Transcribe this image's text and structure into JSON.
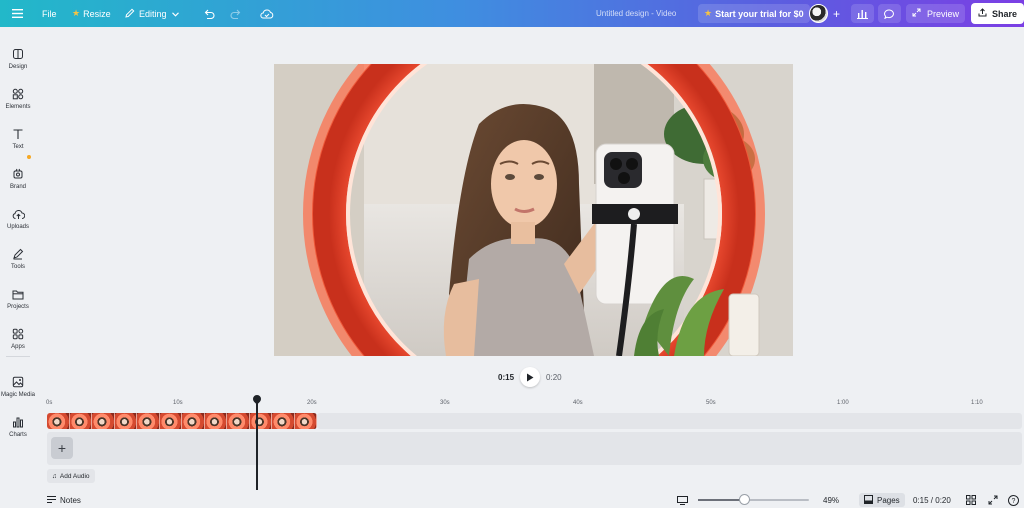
{
  "topbar": {
    "file_label": "File",
    "resize_label": "Resize",
    "editing_label": "Editing",
    "doc_title": "Untitled design - Video",
    "trial_label": "Start your trial for $0",
    "preview_label": "Preview",
    "share_label": "Share"
  },
  "sidebar": {
    "items": [
      {
        "label": "Design",
        "icon": "design-icon"
      },
      {
        "label": "Elements",
        "icon": "elements-icon"
      },
      {
        "label": "Text",
        "icon": "text-icon"
      },
      {
        "label": "Brand",
        "icon": "brand-icon"
      },
      {
        "label": "Uploads",
        "icon": "uploads-icon"
      },
      {
        "label": "Tools",
        "icon": "tools-icon"
      },
      {
        "label": "Projects",
        "icon": "projects-icon"
      },
      {
        "label": "Apps",
        "icon": "apps-icon"
      },
      {
        "label": "Magic Media",
        "icon": "magic-media-icon"
      },
      {
        "label": "Charts",
        "icon": "charts-icon"
      }
    ]
  },
  "playback": {
    "current_time": "0:15",
    "total_time": "0:20"
  },
  "timeline": {
    "ruler_ticks": [
      "0s",
      "10s",
      "20s",
      "30s",
      "40s",
      "50s",
      "1:00",
      "1:10"
    ],
    "add_audio_label": "Add Audio",
    "add_label": "+"
  },
  "bottombar": {
    "notes_label": "Notes",
    "zoom": "49%",
    "pages_label": "Pages",
    "time_readout": "0:15 / 0:20"
  },
  "zoom_fraction": 0.42,
  "colors": {
    "topbar_start": "#22b8c9",
    "topbar_end": "#7b3fe4",
    "brand_dot": "#f6a823",
    "ring_light": "#ff5a3c"
  }
}
